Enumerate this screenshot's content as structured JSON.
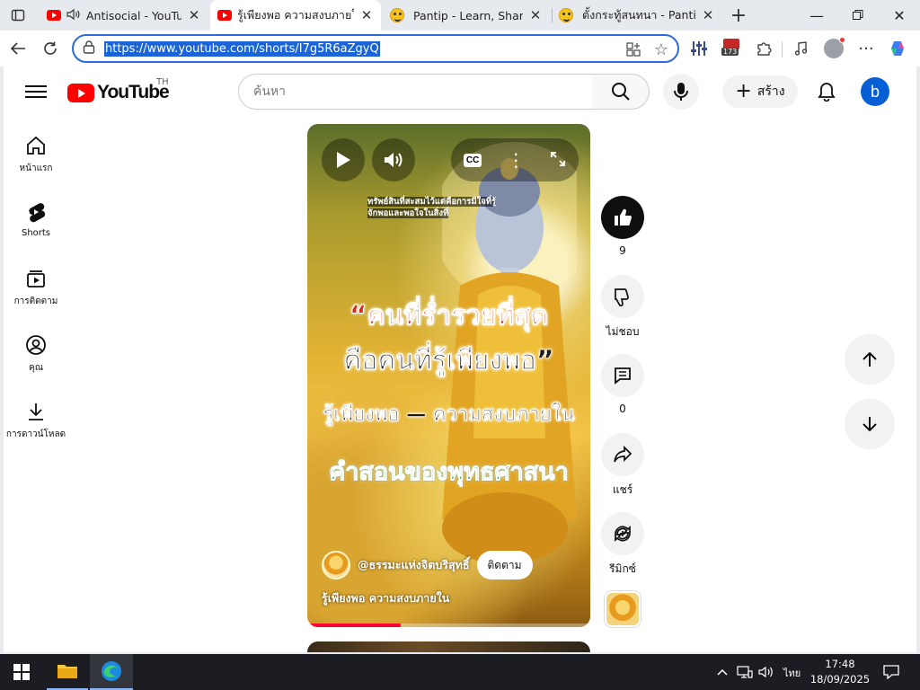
{
  "browser": {
    "tabs": [
      {
        "title": "Antisocial - YouTube",
        "favicon": "youtube-icon",
        "audio": true,
        "active": false
      },
      {
        "title": "รู้เพียงพอ ความสงบภายใน - YouTube",
        "favicon": "youtube-icon",
        "audio": false,
        "active": true
      },
      {
        "title": "Pantip - Learn, Share & Fun",
        "favicon": "pantip-emoji-icon",
        "audio": false,
        "active": false
      },
      {
        "title": "ตั้งกระทู้สนทนา - Pantip",
        "favicon": "pantip-emoji-icon",
        "audio": false,
        "active": false
      }
    ],
    "address_url": "https://www.youtube.com/shorts/I7g5R6aZgyQ",
    "extension_badge": "173"
  },
  "youtube": {
    "logo_text": "YouTube",
    "country_code": "TH",
    "search_placeholder": "ค้นหา",
    "create_label": "สร้าง",
    "avatar_letter": "b",
    "guide": [
      {
        "label": "หน้าแรก",
        "icon": "home-icon"
      },
      {
        "label": "Shorts",
        "icon": "shorts-icon"
      },
      {
        "label": "การติดตาม",
        "icon": "subscriptions-icon"
      },
      {
        "label": "คุณ",
        "icon": "you-icon"
      },
      {
        "label": "การดาวน์โหลด",
        "icon": "download-icon"
      }
    ],
    "short": {
      "overlay_caption_1": "ทรัพย์สินที่สะสมไว้แต่คือการมีใจที่รู้",
      "overlay_caption_2": "จักพอและพอใจในสิ่งที่",
      "headline_1": "“คนที่ร่ำรวยที่สุด",
      "headline_2": "คือคนที่รู้เพียงพอ”",
      "headline_3": "รู้เพียงพอ — ความสงบภายใน",
      "headline_4": "คำสอนของพุทธศาสนา",
      "channel_name": "@ธรรมะแห่งจิตบริสุทธิ์",
      "subscribe_label": "ติดตาม",
      "title": "รู้เพียงพอ  ความสงบภายใน",
      "cc_label": "CC",
      "progress": 0.33
    },
    "actions": {
      "like_count": "9",
      "dislike_label": "ไม่ชอบ",
      "comment_count": "0",
      "share_label": "แชร์",
      "remix_label": "รีมิกซ์"
    }
  },
  "taskbar": {
    "time": "17:48",
    "date": "18/09/2025",
    "language": "ไทย"
  },
  "colors": {
    "accent": "#2e6bd8",
    "youtube_red": "#ff0000",
    "avatar_blue": "#065fd4"
  }
}
